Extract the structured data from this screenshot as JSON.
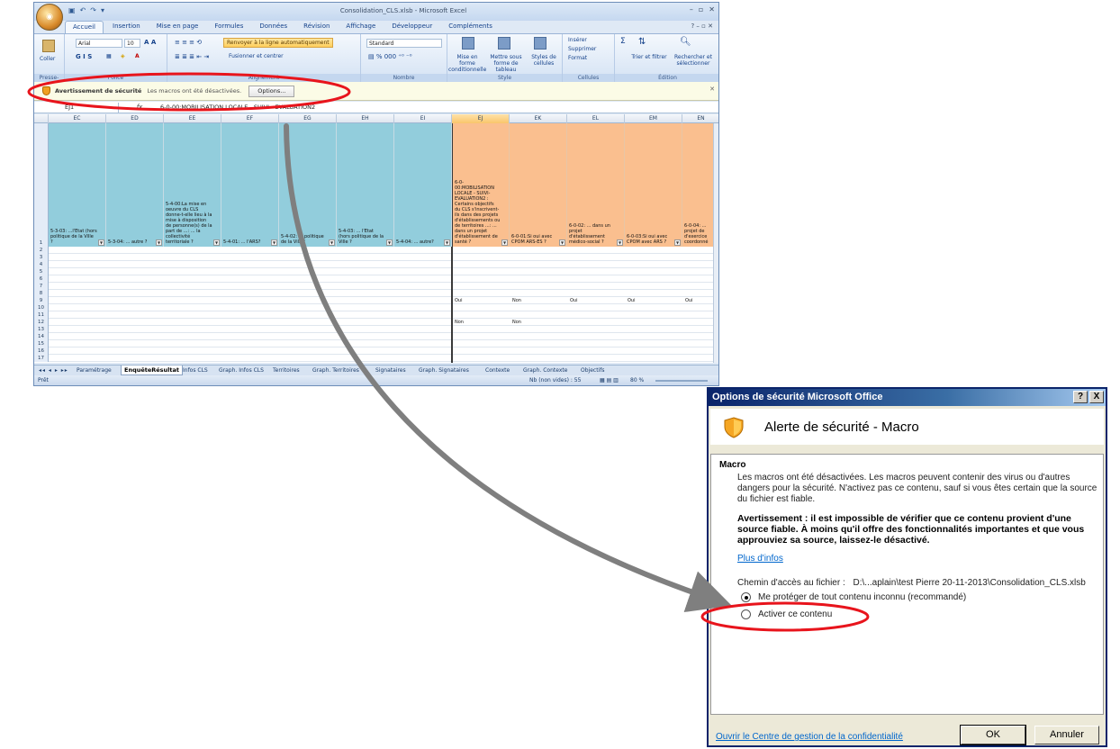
{
  "excel": {
    "window_title": "Consolidation_CLS.xlsb - Microsoft Excel",
    "office_button": "",
    "ribbon_tabs": [
      "Accueil",
      "Insertion",
      "Mise en page",
      "Formules",
      "Données",
      "Révision",
      "Affichage",
      "Développeur",
      "Compléments"
    ],
    "ribbon": {
      "font_name": "Arial",
      "font_size": "10",
      "paste_label": "Coller",
      "wrap_text": "Renvoyer à la ligne automatiquement",
      "merge_center": "Fusionner et centrer",
      "number_format": "Standard",
      "cond_format": "Mise en forme conditionnelle",
      "format_table": "Mettre sous forme de tableau",
      "cell_styles": "Styles de cellules",
      "insert": "Insérer",
      "delete": "Supprimer",
      "format": "Format",
      "sort_filter": "Trier et filtrer",
      "find_select": "Rechercher et sélectionner",
      "groups": [
        "Presse-papiers",
        "Police",
        "Alignement",
        "Nombre",
        "Style",
        "Cellules",
        "Édition"
      ]
    },
    "security_bar": {
      "title": "Avertissement de sécurité",
      "text": "Les macros ont été désactivées.",
      "button": "Options..."
    },
    "formula_bar": {
      "name_box": "EJ1",
      "fx": "fx",
      "content": "6-0-00:MOBILISATION LOCALE - SUIVI - EVALUATION2"
    },
    "columns": [
      "EC",
      "ED",
      "EE",
      "EF",
      "EG",
      "EH",
      "EI",
      "EJ",
      "EK",
      "EL",
      "EM",
      "EN"
    ],
    "header_cells": {
      "EC": "5-3-03: ...l'Etat (hors politique de la Ville ?",
      "ED": "5-3-04: ... autre ?",
      "EE": "5-4-00:La mise en oeuvre du CLS donne-t-elle lieu à la mise à disposition de personne(s) de la part de ...: ... la collectivité territoriale ?",
      "EF": "5-4-01: ... l'ARS?",
      "EG": "5-4-02: ... politique de la Ville?",
      "EH": "5-4-03: ... l'Etat (hors politique de la Ville ?",
      "EI": "5-4-04: ... autre?",
      "EJ": "6-0-00:MOBILISATION LOCALE - SUIVI-EVALUATION2 : Certains objectifs du CLS s'inscrivent-ils dans des projets d'établissements ou de territoires ...: ... dans un projet d'établissement de santé ?",
      "EK": "6-0-01:Si oui avec CPOM ARS-ES ?",
      "EL": "6-0-02: ... dans un projet d'établissement médico-social ?",
      "EM": "6-0-03:Si oui avec CPOM avec ARS ?",
      "EN": "6-0-04: ... projet de d'exercice coordonné"
    },
    "row_numbers": [
      "1",
      "2",
      "3",
      "4",
      "5",
      "6",
      "7",
      "8",
      "9",
      "10",
      "11",
      "12",
      "13",
      "14",
      "15",
      "16",
      "17",
      "18"
    ],
    "data_cells": {
      "row9": {
        "EJ": "Oui",
        "EK": "Non",
        "EL": "Oui",
        "EM": "Oui",
        "EN": "Oui"
      },
      "row12": {
        "EJ": "Non",
        "EK": "Non"
      }
    },
    "sheet_tabs": [
      "Paramétrage",
      "EnquêteRésultat",
      "Infos CLS",
      "Graph. Infos CLS",
      "Territoires",
      "Graph. Territoires",
      "Signataires",
      "Graph. Signataires",
      "Contexte",
      "Graph. Contexte",
      "Objectifs"
    ],
    "active_sheet": "EnquêteRésultat",
    "status": {
      "left": "Prêt",
      "count": "Nb (non vides) : 55",
      "zoom": "80 %"
    }
  },
  "dialog": {
    "title": "Options de sécurité Microsoft Office",
    "help_btn": "?",
    "close_btn": "X",
    "heading": "Alerte de sécurité - Macro",
    "section_title": "Macro",
    "section_text": "Les macros ont été désactivées. Les macros peuvent contenir des virus ou d'autres dangers pour la sécurité. N'activez pas ce contenu, sauf si vous êtes certain que la source du fichier est fiable.",
    "warning": "Avertissement : il est impossible de vérifier que ce contenu provient d'une source fiable. À moins qu'il offre des fonctionnalités importantes et que vous approuviez sa source, laissez-le désactivé.",
    "more_info": "Plus d'infos",
    "path_label": "Chemin d'accès au fichier :",
    "path_value": "D:\\...aplain\\test Pierre 20-11-2013\\Consolidation_CLS.xlsb",
    "option_protect": "Me protéger de tout contenu inconnu (recommandé)",
    "option_enable": "Activer ce contenu",
    "trust_center_link": "Ouvrir le Centre de gestion de la confidentialité",
    "ok": "OK",
    "cancel": "Annuler"
  },
  "colors": {
    "teal_header": "#92cddc",
    "orange_header": "#fabf8f",
    "annotation_red": "#e8141c",
    "arrow_gray": "#7f7f7f"
  }
}
